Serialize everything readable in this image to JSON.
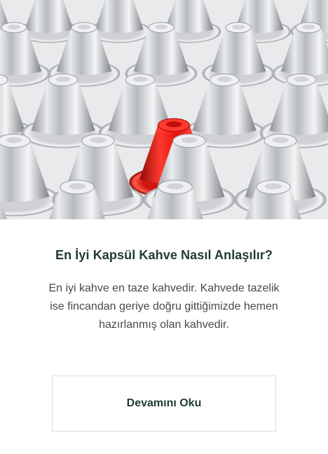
{
  "hero": {
    "image_alt": "Gümüş kapsüller arasında kırmızı kapsül",
    "capsule_color": "#e3130f"
  },
  "article": {
    "title": "En İyi Kapsül Kahve Nasıl Anlaşılır?",
    "description_lines": [
      "En iyi kahve en taze kahvedir. Kahvede tazelik",
      "ise fincandan geriye doğru gittiğimizde hemen",
      "hazırlanmış olan kahvedir."
    ]
  },
  "actions": {
    "read_more_label": "Devamını Oku"
  },
  "colors": {
    "title": "#1f3a35",
    "text": "#4a4a4a",
    "border": "#dcdcdc"
  }
}
